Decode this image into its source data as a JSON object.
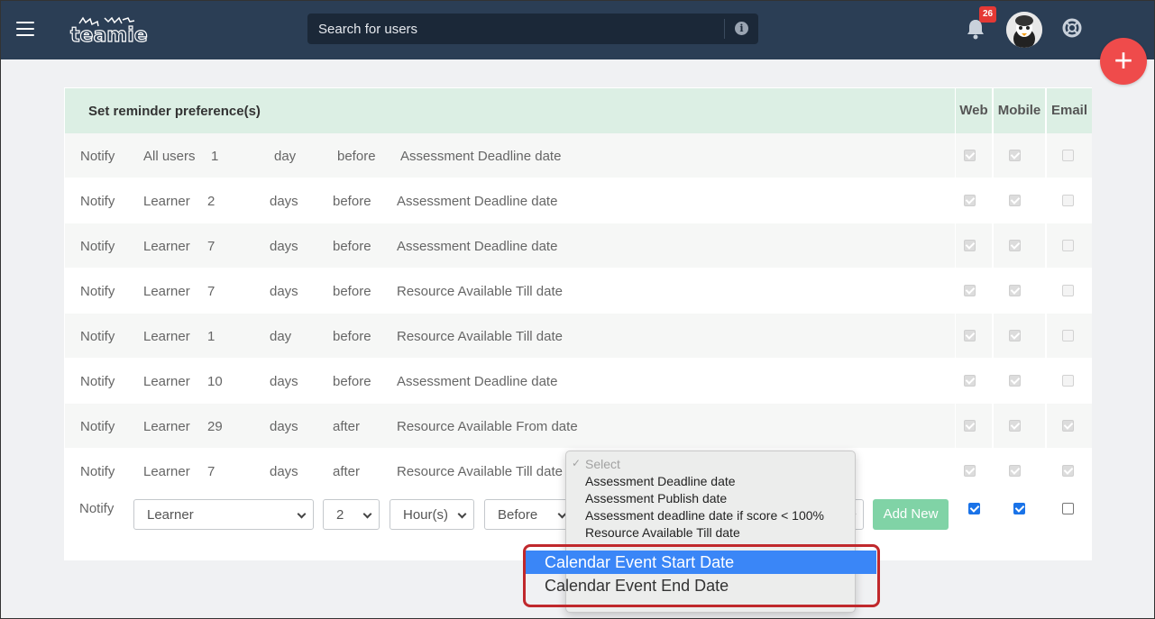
{
  "header": {
    "search_placeholder": "Search for users",
    "notification_count": "26"
  },
  "panel": {
    "title": "Set reminder preference(s)",
    "columns": [
      "Web",
      "Mobile",
      "Email"
    ]
  },
  "reminders": [
    {
      "action": "Notify",
      "audience": "All users",
      "amount": "1",
      "unit": "day",
      "relation": "before",
      "event": "Assessment Deadline date",
      "web": true,
      "mobile": true,
      "email": false
    },
    {
      "action": "Notify",
      "audience": "Learner",
      "amount": "2",
      "unit": "days",
      "relation": "before",
      "event": "Assessment Deadline date",
      "web": true,
      "mobile": true,
      "email": false
    },
    {
      "action": "Notify",
      "audience": "Learner",
      "amount": "7",
      "unit": "days",
      "relation": "before",
      "event": "Assessment Deadline date",
      "web": true,
      "mobile": true,
      "email": false
    },
    {
      "action": "Notify",
      "audience": "Learner",
      "amount": "7",
      "unit": "days",
      "relation": "before",
      "event": "Resource Available Till date",
      "web": true,
      "mobile": true,
      "email": false
    },
    {
      "action": "Notify",
      "audience": "Learner",
      "amount": "1",
      "unit": "day",
      "relation": "before",
      "event": "Resource Available Till date",
      "web": true,
      "mobile": true,
      "email": false
    },
    {
      "action": "Notify",
      "audience": "Learner",
      "amount": "10",
      "unit": "days",
      "relation": "before",
      "event": "Assessment Deadline date",
      "web": true,
      "mobile": true,
      "email": false
    },
    {
      "action": "Notify",
      "audience": "Learner",
      "amount": "29",
      "unit": "days",
      "relation": "after",
      "event": "Resource Available From date",
      "web": true,
      "mobile": true,
      "email": true
    },
    {
      "action": "Notify",
      "audience": "Learner",
      "amount": "7",
      "unit": "days",
      "relation": "after",
      "event": "Resource Available Till date",
      "web": true,
      "mobile": true,
      "email": true
    }
  ],
  "new_reminder": {
    "action": "Notify",
    "audience": "Learner",
    "amount": "2",
    "unit": "Hour(s)",
    "relation": "Before",
    "add_label": "Add New",
    "web": true,
    "mobile": true,
    "email": false
  },
  "event_dropdown": {
    "options": [
      "Select",
      "Assessment Deadline date",
      "Assessment Publish date",
      "Assessment deadline date if score < 100%",
      "Resource Available Till date",
      "Calendar Event Start Date",
      "Calendar Event End Date"
    ],
    "selected": "Calendar Event Start Date"
  },
  "colors": {
    "topbar": "#2b3e55",
    "header_bg": "#dcefe4",
    "add_button": "#80d3a6",
    "fab": "#ef4b4b",
    "highlight": "#c0282c",
    "selected_option": "#3a86f7"
  }
}
